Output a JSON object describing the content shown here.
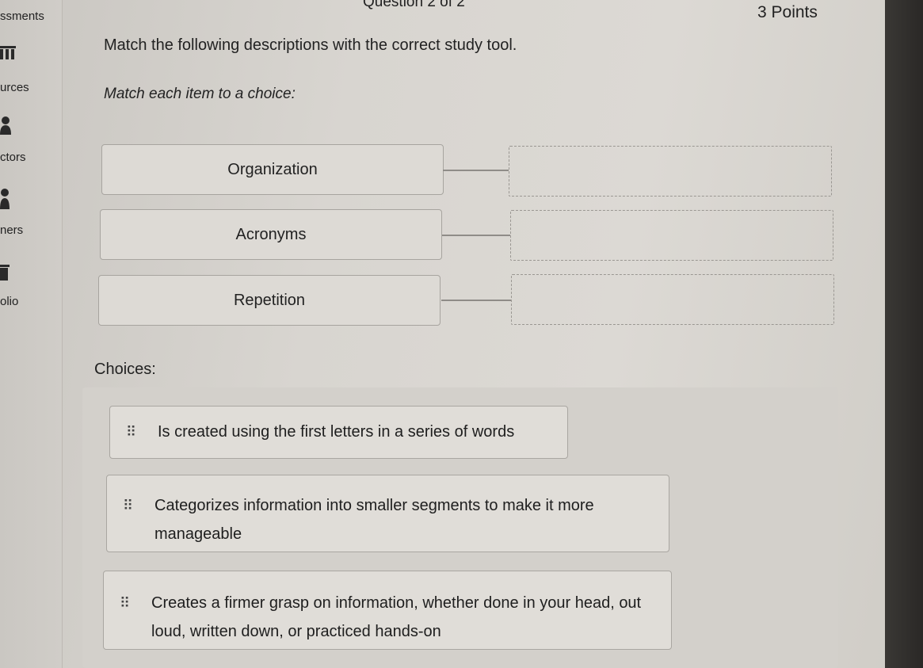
{
  "header": {
    "question_label": "Question 2 of 2",
    "points": "3 Points"
  },
  "sidebar": {
    "items": [
      {
        "label": "ssments",
        "icon": "grid-icon"
      },
      {
        "label": "urces",
        "icon": "person-icon"
      },
      {
        "label": "ctors",
        "icon": "people-icon"
      },
      {
        "label": "ners",
        "icon": "folder-icon"
      },
      {
        "label": "olio",
        "icon": ""
      }
    ]
  },
  "question": {
    "prompt": "Match the following descriptions with the correct study tool.",
    "instruction": "Match each item to a choice:"
  },
  "items": [
    {
      "label": "Organization"
    },
    {
      "label": "Acronyms"
    },
    {
      "label": "Repetition"
    }
  ],
  "choices_label": "Choices:",
  "choices": [
    {
      "text": "Is created using the first letters in a series of words"
    },
    {
      "text": "Categorizes information into smaller segments to make it more manageable"
    },
    {
      "text": "Creates a firmer grasp on information, whether done in your head, out loud, written down, or practiced hands-on"
    }
  ],
  "colors": {
    "background": "#d6d3ce",
    "text": "#1d1d1d",
    "border": "#a7a49f"
  }
}
